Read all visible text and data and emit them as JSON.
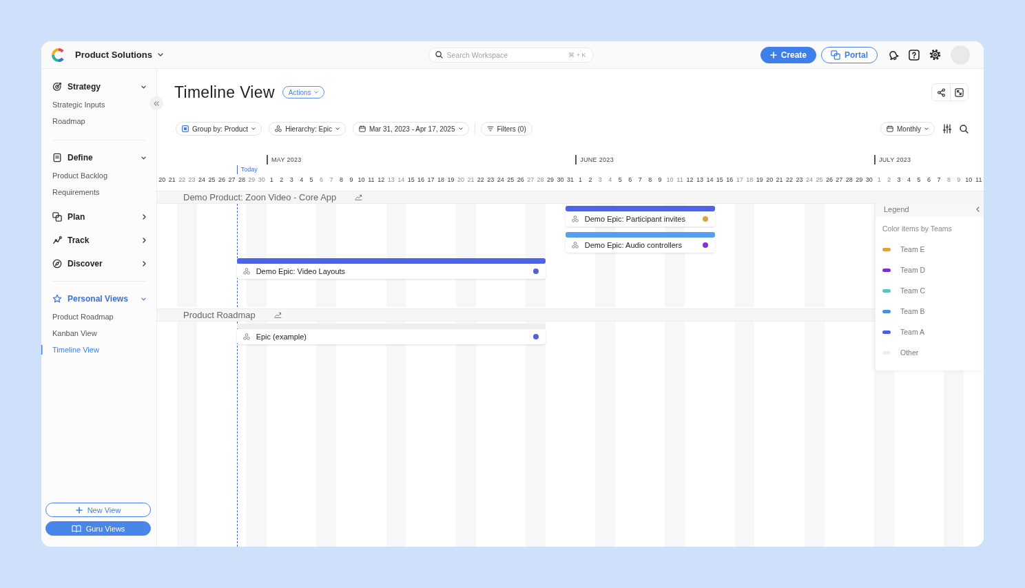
{
  "topbar": {
    "workspace": "Product Solutions",
    "search": {
      "placeholder": "Search Workspace",
      "shortcut": "⌘ + K"
    },
    "buttons": [
      {
        "label": "Create",
        "kind": "primary"
      },
      {
        "label": "Portal",
        "kind": "outline"
      }
    ]
  },
  "sidebar": {
    "groups": [
      {
        "sections": [
          {
            "label": "Strategy",
            "expanded": true,
            "items": [
              {
                "label": "Strategic Inputs",
                "selected": false
              },
              {
                "label": "Roadmap",
                "selected": false
              }
            ]
          }
        ]
      },
      {
        "sections": [
          {
            "label": "Define",
            "expanded": true,
            "items": [
              {
                "label": "Product Backlog",
                "selected": false
              },
              {
                "label": "Requirements",
                "selected": false
              }
            ]
          },
          {
            "label": "Plan",
            "expanded": false
          },
          {
            "label": "Track",
            "expanded": false
          },
          {
            "label": "Discover",
            "expanded": false
          }
        ]
      },
      {
        "sections": [
          {
            "label": "Personal Views",
            "expanded": true,
            "items": [
              {
                "label": "Product Roadmap",
                "selected": false
              },
              {
                "label": "Kanban View",
                "selected": false
              },
              {
                "label": "Timeline View",
                "selected": true
              }
            ]
          }
        ]
      }
    ],
    "buttons": [
      {
        "label": "New View",
        "kind": "outline"
      },
      {
        "label": "Guru Views",
        "kind": "primary"
      }
    ]
  },
  "page": {
    "title": "Timeline View",
    "actions": "Actions"
  },
  "toolbar": {
    "controls": [
      {
        "label": "Group by: Product",
        "kind": "group"
      },
      {
        "label": "Hierarchy: Epic",
        "kind": "hierarchy"
      },
      {
        "label": "Mar 31, 2023 - Apr 17, 2025",
        "kind": "dates"
      },
      {
        "label": "Filters (0)",
        "kind": "filters"
      }
    ],
    "zoom": "Monthly"
  },
  "timeline": {
    "months": [
      {
        "days": [
          {
            "label": "20",
            "weekend": false
          },
          {
            "label": "21",
            "weekend": false
          },
          {
            "label": "22",
            "weekend": true
          },
          {
            "label": "23",
            "weekend": true
          },
          {
            "label": "24",
            "weekend": false
          },
          {
            "label": "25",
            "weekend": false
          },
          {
            "label": "26",
            "weekend": false
          },
          {
            "label": "27",
            "weekend": false
          },
          {
            "label": "28",
            "weekend": false,
            "marker": "Today"
          },
          {
            "label": "29",
            "weekend": true
          },
          {
            "label": "30",
            "weekend": true
          }
        ]
      },
      {
        "label": "MAY 2023",
        "days": [
          {
            "label": "1",
            "weekend": false
          },
          {
            "label": "2",
            "weekend": false
          },
          {
            "label": "3",
            "weekend": false
          },
          {
            "label": "4",
            "weekend": false
          },
          {
            "label": "5",
            "weekend": false
          },
          {
            "label": "6",
            "weekend": true
          },
          {
            "label": "7",
            "weekend": true
          },
          {
            "label": "8",
            "weekend": false
          },
          {
            "label": "9",
            "weekend": false
          },
          {
            "label": "10",
            "weekend": false
          },
          {
            "label": "11",
            "weekend": false
          },
          {
            "label": "12",
            "weekend": false
          },
          {
            "label": "13",
            "weekend": true
          },
          {
            "label": "14",
            "weekend": true
          },
          {
            "label": "15",
            "weekend": false
          },
          {
            "label": "16",
            "weekend": false
          },
          {
            "label": "17",
            "weekend": false
          },
          {
            "label": "18",
            "weekend": false
          },
          {
            "label": "19",
            "weekend": false
          },
          {
            "label": "20",
            "weekend": true
          },
          {
            "label": "21",
            "weekend": true
          },
          {
            "label": "22",
            "weekend": false
          },
          {
            "label": "23",
            "weekend": false
          },
          {
            "label": "24",
            "weekend": false
          },
          {
            "label": "25",
            "weekend": false
          },
          {
            "label": "26",
            "weekend": false
          },
          {
            "label": "27",
            "weekend": true
          },
          {
            "label": "28",
            "weekend": true
          },
          {
            "label": "29",
            "weekend": false
          },
          {
            "label": "30",
            "weekend": false
          },
          {
            "label": "31",
            "weekend": false
          }
        ]
      },
      {
        "label": "JUNE 2023",
        "days": [
          {
            "label": "1",
            "weekend": false
          },
          {
            "label": "2",
            "weekend": false
          },
          {
            "label": "3",
            "weekend": true
          },
          {
            "label": "4",
            "weekend": true
          },
          {
            "label": "5",
            "weekend": false
          },
          {
            "label": "6",
            "weekend": false
          },
          {
            "label": "7",
            "weekend": false
          },
          {
            "label": "8",
            "weekend": false
          },
          {
            "label": "9",
            "weekend": false
          },
          {
            "label": "10",
            "weekend": true
          },
          {
            "label": "11",
            "weekend": true
          },
          {
            "label": "12",
            "weekend": false
          },
          {
            "label": "13",
            "weekend": false
          },
          {
            "label": "14",
            "weekend": false
          },
          {
            "label": "15",
            "weekend": false
          },
          {
            "label": "16",
            "weekend": false
          },
          {
            "label": "17",
            "weekend": true
          },
          {
            "label": "18",
            "weekend": true
          },
          {
            "label": "19",
            "weekend": false
          },
          {
            "label": "20",
            "weekend": false
          },
          {
            "label": "21",
            "weekend": false
          },
          {
            "label": "22",
            "weekend": false
          },
          {
            "label": "23",
            "weekend": false
          },
          {
            "label": "24",
            "weekend": true
          },
          {
            "label": "25",
            "weekend": true
          },
          {
            "label": "26",
            "weekend": false
          },
          {
            "label": "27",
            "weekend": false
          },
          {
            "label": "28",
            "weekend": false
          },
          {
            "label": "29",
            "weekend": false
          },
          {
            "label": "30",
            "weekend": false
          }
        ]
      },
      {
        "label": "JULY 2023",
        "days": [
          {
            "label": "1",
            "weekend": true
          },
          {
            "label": "2",
            "weekend": true
          },
          {
            "label": "3",
            "weekend": false
          },
          {
            "label": "4",
            "weekend": false
          },
          {
            "label": "5",
            "weekend": false
          },
          {
            "label": "6",
            "weekend": false
          },
          {
            "label": "7",
            "weekend": false
          },
          {
            "label": "8",
            "weekend": true
          },
          {
            "label": "9",
            "weekend": true
          },
          {
            "label": "10",
            "weekend": false
          },
          {
            "label": "11",
            "weekend": false
          }
        ]
      }
    ],
    "groups": [
      {
        "title": "Demo Product: Zoon Video - Core App",
        "epics": [
          {
            "title": "Demo Epic: Participant invites",
            "color": "#4f63e6",
            "dot": {
              "color": "#e0a33c"
            }
          },
          {
            "title": "Demo Epic: Audio controllers",
            "color": "#55a0ec",
            "dot": {
              "color": "#8533d6"
            }
          },
          {
            "title": "Demo Epic: Video Layouts",
            "color": "#4f63e6",
            "dot": {
              "color": "#5560dc"
            }
          }
        ]
      },
      {
        "title": "Product Roadmap",
        "epics": [
          {
            "title": "Epic (example)",
            "color": "#eeeeee",
            "dot": {
              "color": "#5560dc"
            }
          }
        ]
      }
    ]
  },
  "legend": {
    "title": "Legend",
    "subtitle": "Color items by Teams",
    "items": [
      {
        "label": "Team E",
        "color": "#e0a33c"
      },
      {
        "label": "Team D",
        "color": "#7b2fd0"
      },
      {
        "label": "Team C",
        "color": "#5cc4bc"
      },
      {
        "label": "Team B",
        "color": "#4a90e2"
      },
      {
        "label": "Team A",
        "color": "#4f5fd8"
      },
      {
        "label": "Other",
        "color": "#eeeeee"
      }
    ]
  }
}
